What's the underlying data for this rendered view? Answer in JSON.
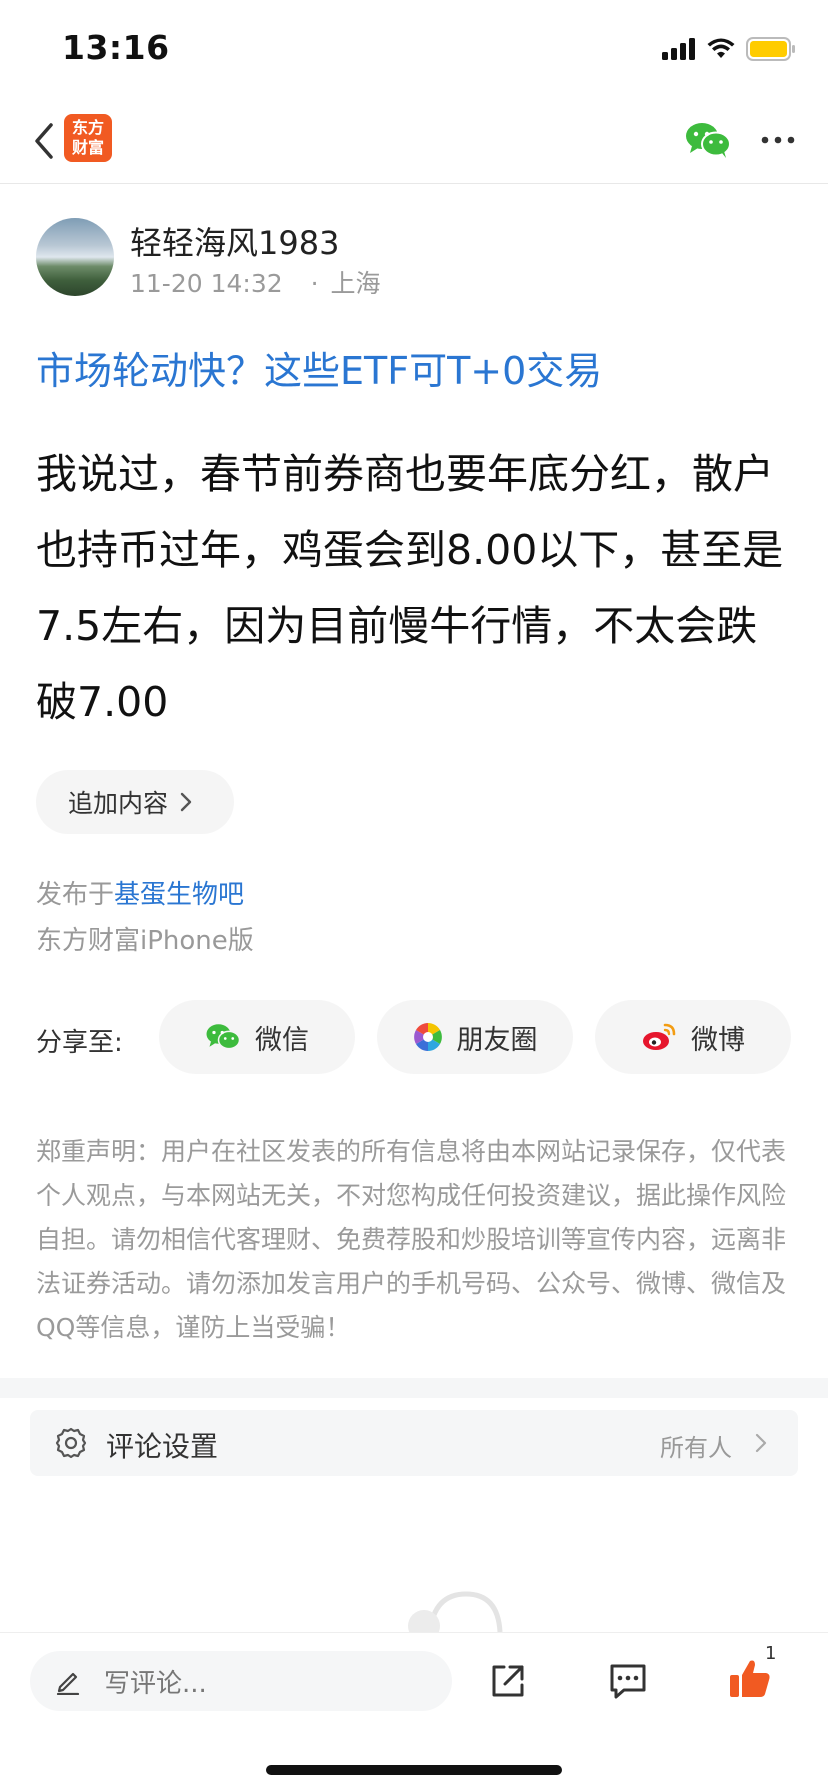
{
  "status_bar": {
    "time": "13:16"
  },
  "nav": {
    "logo_line1": "东方",
    "logo_line2": "财富"
  },
  "author": {
    "name": "轻轻海风1983",
    "time": "11-20 14:32",
    "separator": "·",
    "location": "上海"
  },
  "post": {
    "title": "市场轮动快？这些ETF可T+0交易",
    "body": "我说过，春节前券商也要年底分红，散户也持币过年，鸡蛋会到8.00以下，甚至是7.5左右，因为目前慢牛行情，不太会跌破7.00"
  },
  "append_button": {
    "label": "追加内容"
  },
  "published": {
    "prefix": "发布于",
    "forum": "基蛋生物吧",
    "platform": "东方财富iPhone版"
  },
  "share": {
    "label": "分享至:",
    "wechat": "微信",
    "moments": "朋友圈",
    "weibo": "微博"
  },
  "disclaimer": "郑重声明：用户在社区发表的所有信息将由本网站记录保存，仅代表个人观点，与本网站无关，不对您构成任何投资建议，据此操作风险自担。请勿相信代客理财、免费荐股和炒股培训等宣传内容，远离非法证券活动。请勿添加发言用户的手机号码、公众号、微博、微信及QQ等信息，谨防上当受骗！",
  "comment_settings": {
    "label": "评论设置",
    "value": "所有人"
  },
  "bottom_bar": {
    "comment_placeholder": "写评论...",
    "like_count": "1"
  },
  "colors": {
    "link_blue": "#2a76d2",
    "brand_orange": "#f15a22",
    "wechat_green": "#3dbb3d",
    "battery_yellow": "#ffcc00"
  }
}
